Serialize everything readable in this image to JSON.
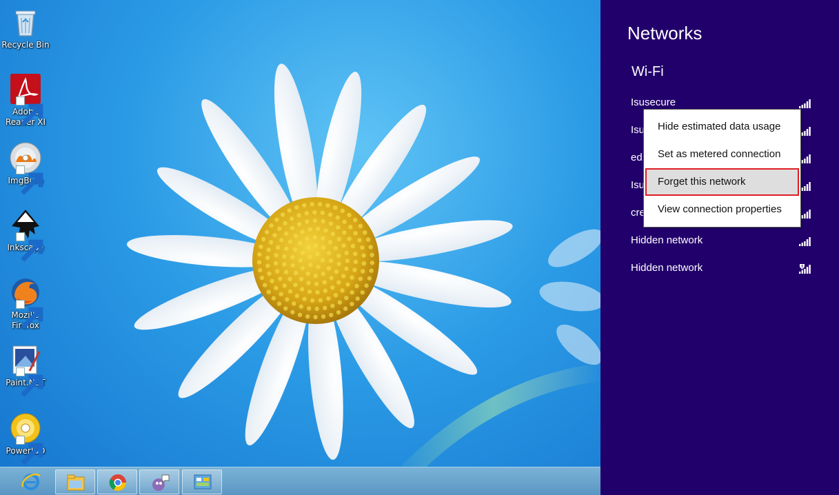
{
  "desktop": {
    "icons": [
      {
        "label": "Recycle Bin",
        "icon": "recycle-bin-icon"
      },
      {
        "label": "Adobe Reader XI",
        "icon": "adobe-reader-icon"
      },
      {
        "label": "ImgBurn",
        "icon": "imgburn-icon"
      },
      {
        "label": "Inkscape",
        "icon": "inkscape-icon"
      },
      {
        "label": "Mozilla Firefox",
        "icon": "firefox-icon"
      },
      {
        "label": "Paint.NET",
        "icon": "paint-net-icon"
      },
      {
        "label": "PowerISO",
        "icon": "poweriso-icon"
      }
    ]
  },
  "taskbar": {
    "items": [
      {
        "icon": "internet-explorer-icon"
      },
      {
        "icon": "file-explorer-icon"
      },
      {
        "icon": "chrome-icon"
      },
      {
        "icon": "pidgin-icon"
      },
      {
        "icon": "control-panel-icon"
      }
    ]
  },
  "panel": {
    "title": "Networks",
    "wifi_heading": "Wi-Fi",
    "networks": [
      {
        "name": "Isusecure",
        "signal": 5,
        "secured": false
      },
      {
        "name": "Isu",
        "signal": 5,
        "secured": false
      },
      {
        "name": "ed",
        "signal": 5,
        "secured": false
      },
      {
        "name": "Isu",
        "signal": 5,
        "secured": false
      },
      {
        "name": "cre",
        "signal": 5,
        "secured": false
      },
      {
        "name": "Hidden network",
        "signal": 5,
        "secured": false
      },
      {
        "name": "Hidden network",
        "signal": 5,
        "secured": true
      }
    ]
  },
  "context_menu": {
    "items": [
      {
        "label": "Hide estimated data usage"
      },
      {
        "label": "Set as metered connection"
      },
      {
        "label": "Forget this network"
      },
      {
        "label": "View connection properties"
      }
    ],
    "highlighted_index": 2,
    "highlight_border_color": "#e01b24"
  },
  "colors": {
    "panel_bg": "#22006b",
    "taskbar": "#6aa6cf"
  }
}
